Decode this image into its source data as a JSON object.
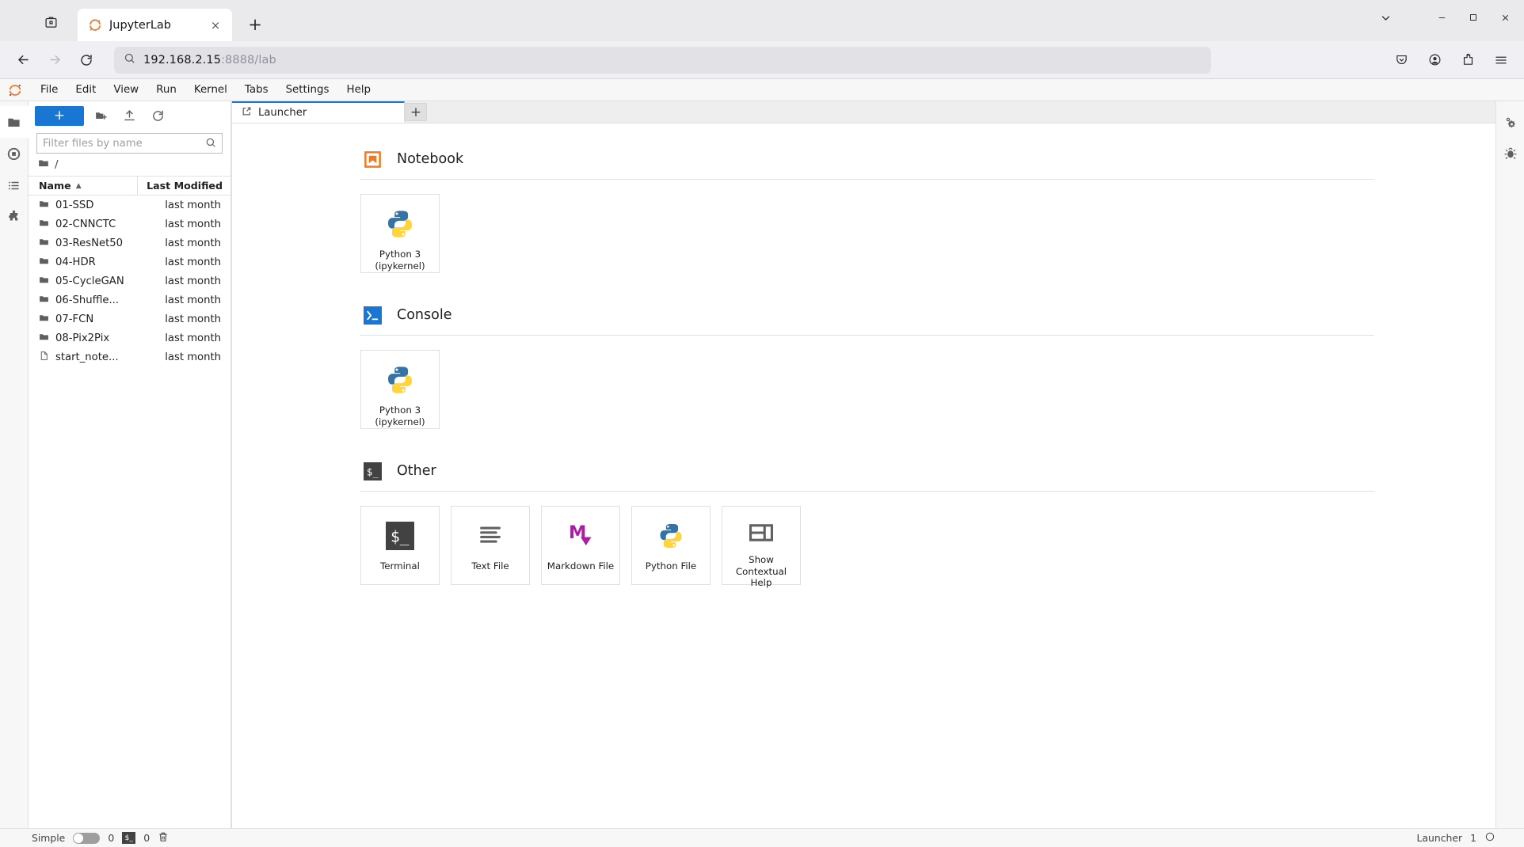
{
  "browser": {
    "tab": {
      "title": "JupyterLab",
      "favicon": "jupyter-favicon",
      "close": "×"
    },
    "new_tab_label": "+",
    "window_controls": {
      "list_all": "chevron-down",
      "minimize": "−",
      "maximize": "□",
      "close": "×"
    },
    "nav": {
      "back": "←",
      "forward": "→",
      "reload": "⟳"
    },
    "url": {
      "host": "192.168.2.15",
      "rest": ":8888/lab"
    },
    "tools": [
      "pocket-icon",
      "account-icon",
      "extensions-icon",
      "app-menu-icon"
    ]
  },
  "jupyter": {
    "menubar": [
      "File",
      "Edit",
      "View",
      "Run",
      "Kernel",
      "Tabs",
      "Settings",
      "Help"
    ],
    "left_sidebar": [
      {
        "name": "file-browser",
        "icon": "folder-icon",
        "active": true
      },
      {
        "name": "running-sessions",
        "icon": "stop-circle-icon",
        "active": false
      },
      {
        "name": "commands",
        "icon": "list-icon",
        "active": false
      },
      {
        "name": "extensions",
        "icon": "puzzle-icon",
        "active": false
      }
    ],
    "right_sidebar": [
      {
        "name": "property-inspector",
        "icon": "gears-icon"
      },
      {
        "name": "debugger",
        "icon": "bug-icon"
      }
    ],
    "filebrowser": {
      "new_button_label": "+",
      "toolbar_icons": [
        "new-folder-icon",
        "upload-icon",
        "refresh-icon"
      ],
      "filter_placeholder": "Filter files by name",
      "filter_value": "",
      "breadcrumb": "/",
      "columns": {
        "name": "Name",
        "modified": "Last Modified"
      },
      "sort_indicator": "▲",
      "items": [
        {
          "name": "01-SSD",
          "type": "folder",
          "modified": "last month"
        },
        {
          "name": "02-CNNCTC",
          "type": "folder",
          "modified": "last month"
        },
        {
          "name": "03-ResNet50",
          "type": "folder",
          "modified": "last month"
        },
        {
          "name": "04-HDR",
          "type": "folder",
          "modified": "last month"
        },
        {
          "name": "05-CycleGAN",
          "type": "folder",
          "modified": "last month"
        },
        {
          "name": "06-Shuffle...",
          "type": "folder",
          "modified": "last month"
        },
        {
          "name": "07-FCN",
          "type": "folder",
          "modified": "last month"
        },
        {
          "name": "08-Pix2Pix",
          "type": "folder",
          "modified": "last month"
        },
        {
          "name": "start_note...",
          "type": "file",
          "modified": "last month"
        }
      ]
    },
    "tabbar": {
      "tab_label": "Launcher",
      "tab_icon": "launcher-icon",
      "add_label": "+"
    },
    "launcher": {
      "sections": [
        {
          "title": "Notebook",
          "icon": "notebook-icon",
          "cards": [
            {
              "label": "Python 3\n(ipykernel)",
              "icon": "python-icon"
            }
          ]
        },
        {
          "title": "Console",
          "icon": "console-icon",
          "cards": [
            {
              "label": "Python 3\n(ipykernel)",
              "icon": "python-icon"
            }
          ]
        },
        {
          "title": "Other",
          "icon": "terminal-icon",
          "cards": [
            {
              "label": "Terminal",
              "icon": "terminal-icon"
            },
            {
              "label": "Text File",
              "icon": "text-file-icon"
            },
            {
              "label": "Markdown File",
              "icon": "markdown-icon"
            },
            {
              "label": "Python File",
              "icon": "python-icon"
            },
            {
              "label": "Show\nContextual Help",
              "icon": "contextual-help-icon"
            }
          ]
        }
      ]
    },
    "statusbar": {
      "mode_label": "Simple",
      "mode_on": false,
      "kernel_count": "0",
      "terminal_count": "0",
      "terminal_icon": "terminal-badge-icon",
      "trash_icon": "trash-icon",
      "active_tab": "Launcher",
      "active_count": "1",
      "kernel_status_icon": "kernel-idle-icon"
    }
  },
  "colors": {
    "accent_blue": "#1976d2",
    "notebook_orange": "#ee7b24",
    "markdown_purple": "#ab1ea4",
    "python_blue": "#3572a5",
    "python_yellow": "#ffd43b",
    "terminal_dark": "#424242"
  }
}
